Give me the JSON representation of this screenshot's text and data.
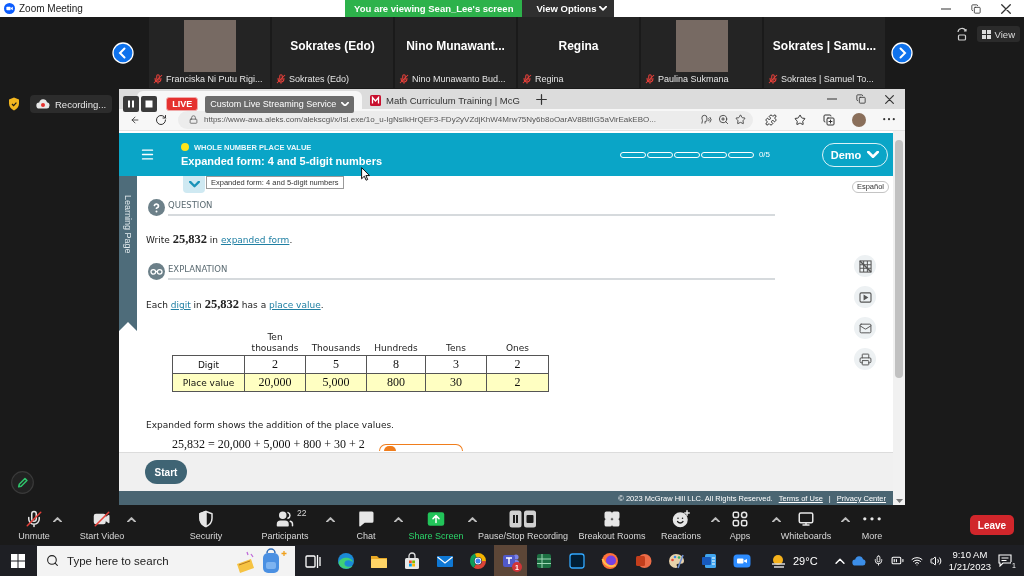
{
  "zoom_window": {
    "title": "Zoom Meeting",
    "banner": "You are viewing Sean_Lee's screen",
    "view_options": "View Options"
  },
  "participants": [
    {
      "kind": "photo",
      "name": "Franciska Ni Putu Rigi...",
      "muted": true
    },
    {
      "kind": "name",
      "display_name": "Sokrates (Edo)",
      "name": "Sokrates (Edo)",
      "muted": true
    },
    {
      "kind": "name",
      "display_name": "Nino Munawant...",
      "name": "Nino Munawanto Bud...",
      "muted": true
    },
    {
      "kind": "name",
      "display_name": "Regina",
      "name": "Regina",
      "muted": true
    },
    {
      "kind": "photo",
      "name": "Paulina Sukmana",
      "muted": true
    },
    {
      "kind": "name",
      "display_name": "Sokrates | Samu...",
      "name": "Sokrates | Samuel To...",
      "muted": true
    }
  ],
  "view_button": "View",
  "recording": {
    "label": "Recording...",
    "live": "LIVE",
    "stream_service": "Custom Live Streaming Service"
  },
  "browser": {
    "tabs": [
      {
        "selected": true
      },
      {
        "title": "Math Curriculum Training | McG",
        "selected": false
      }
    ],
    "url": "https://www-awa.aleks.com/alekscgi/x/Isl.exe/1o_u-IgNsIkHrQEF3-FDy2yVZdjKhW4Mrw75Ny6b8oOarAV8BttIG5aVirEakEBO..."
  },
  "aleks": {
    "topic": "WHOLE NUMBER PLACE VALUE",
    "title": "Expanded form: 4 and 5-digit numbers",
    "progress": {
      "segments": [
        {
          "done": false
        },
        {
          "done": false
        },
        {
          "done": false
        },
        {
          "done": false
        },
        {
          "done": false
        }
      ],
      "reading": "0/5"
    },
    "menu_button": "Demo",
    "tooltip": "Expanded form: 4 and 5-digit numbers",
    "side_tab": "Learning Page",
    "language": "Español",
    "question": {
      "heading": "QUESTION",
      "sentence": [
        {
          "kind": "text",
          "text": "Write **25,832** in "
        },
        {
          "kind": "link",
          "text": "expanded form"
        },
        {
          "kind": "text",
          "text": "."
        }
      ]
    },
    "explanation": {
      "heading": "EXPLANATION",
      "sentence": [
        {
          "kind": "text",
          "text": "Each "
        },
        {
          "kind": "link",
          "text": "digit"
        },
        {
          "kind": "text",
          "text": " in **25,832** has a "
        },
        {
          "kind": "link",
          "text": "place value"
        },
        {
          "kind": "text",
          "text": "."
        }
      ],
      "table": {
        "columns": [
          "Ten thousands",
          "Thousands",
          "Hundreds",
          "Tens",
          "Ones"
        ],
        "rows": [
          {
            "label": "Digit",
            "highlighted": false,
            "cells": [
              "2",
              "5",
              "8",
              "3",
              "2"
            ]
          },
          {
            "label": "Place value",
            "highlighted": true,
            "cells": [
              "20,000",
              "5,000",
              "800",
              "30",
              "2"
            ]
          }
        ]
      },
      "note": "Expanded form shows the addition of the place values.",
      "equation": "25,832 = 20,000 + 5,000 + 800 + 30 + 2"
    },
    "start_button": "Start",
    "footer": {
      "copyright": "© 2023 McGraw Hill LLC. All Rights Reserved.",
      "links": [
        "Terms of Use",
        "Privacy Center"
      ],
      "separator": "|"
    }
  },
  "toolbar": {
    "tools": [
      {
        "kind": "mic",
        "label": "Unmute",
        "off": true,
        "caret": true
      },
      {
        "kind": "video",
        "label": "Start Video",
        "off": true,
        "caret": true
      },
      {
        "kind": "security",
        "label": "Security",
        "caret": false
      },
      {
        "kind": "participants",
        "label": "Participants",
        "count": "22",
        "caret": true
      },
      {
        "kind": "chat",
        "label": "Chat",
        "caret": true
      },
      {
        "kind": "share",
        "label": "Share Screen",
        "caret": true
      },
      {
        "kind": "recording",
        "label": "Pause/Stop Recording",
        "caret": false
      },
      {
        "kind": "breakout",
        "label": "Breakout Rooms",
        "caret": false
      },
      {
        "kind": "reactions",
        "label": "Reactions",
        "caret": true
      },
      {
        "kind": "apps",
        "label": "Apps",
        "caret": true
      },
      {
        "kind": "whiteboards",
        "label": "Whiteboards",
        "caret": true
      },
      {
        "kind": "more",
        "label": "More",
        "caret": false
      }
    ],
    "leave": "Leave"
  },
  "taskbar": {
    "search": {
      "placeholder": "Type here to search"
    },
    "apps": [
      {
        "kind": "task-view",
        "active": false
      },
      {
        "kind": "browser",
        "active": false
      },
      {
        "kind": "folder",
        "active": false
      },
      {
        "kind": "store",
        "active": false
      },
      {
        "kind": "mail",
        "active": false
      },
      {
        "kind": "browser-round",
        "active": false
      },
      {
        "kind": "chat-app",
        "active": true,
        "badge": "1"
      },
      {
        "kind": "spreadsheet",
        "active": false
      },
      {
        "kind": "image-editor",
        "active": false
      },
      {
        "kind": "browser-fox",
        "active": false
      },
      {
        "kind": "slides",
        "active": false
      },
      {
        "kind": "paint",
        "active": false
      },
      {
        "kind": "document",
        "active": false
      },
      {
        "kind": "video-call",
        "active": false
      }
    ],
    "weather": "29°C",
    "time": "9:10 AM",
    "date": "1/21/2023",
    "notification_badge": "1"
  }
}
